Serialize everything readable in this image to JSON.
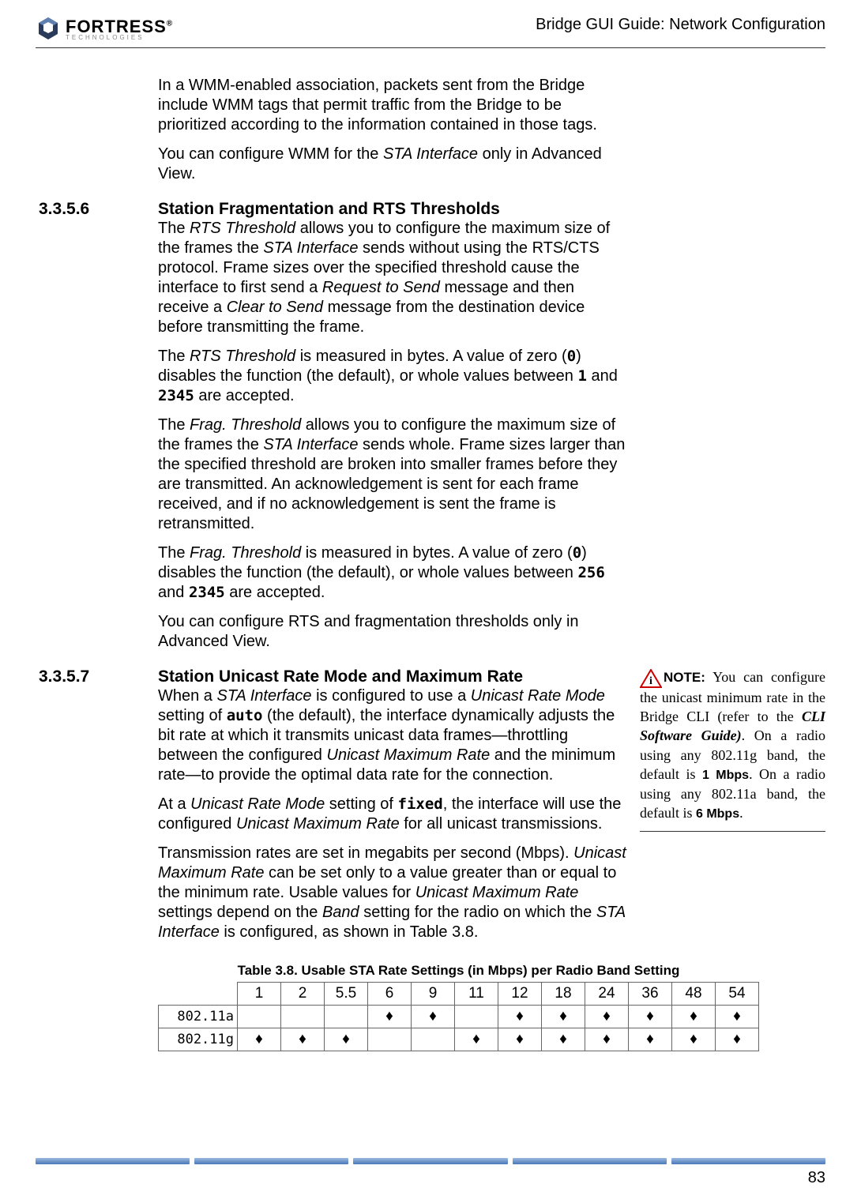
{
  "header": {
    "logo_name": "FORTRESS",
    "logo_sub": "TECHNOLOGIES",
    "title": "Bridge GUI Guide: Network Configuration"
  },
  "intro": {
    "p1_a": "In a WMM-enabled association, packets sent from the Bridge include WMM tags that permit traffic from the Bridge to be prioritized according to the information contained in those tags.",
    "p2_a": "You can configure WMM for the ",
    "p2_i": "STA Interface",
    "p2_b": " only in Advanced View."
  },
  "sec6": {
    "num": "3.3.5.6",
    "title": "Station Fragmentation and RTS Thresholds",
    "p1_a": "The ",
    "p1_i1": "RTS Threshold",
    "p1_b": " allows you to configure the maximum size of the frames the ",
    "p1_i2": "STA Interface",
    "p1_c": " sends without using the RTS/CTS protocol. Frame sizes over the specified threshold cause the interface to first send a ",
    "p1_i3": "Request to Send",
    "p1_d": " message and then receive a ",
    "p1_i4": "Clear to Send",
    "p1_e": " message from the destination device before transmitting the frame.",
    "p2_a": "The ",
    "p2_i": "RTS Threshold",
    "p2_b": " is measured in bytes. A value of zero (",
    "p2_m1": "0",
    "p2_c": ") disables the function (the default), or whole values between ",
    "p2_m2": "1",
    "p2_d": " and ",
    "p2_m3": "2345",
    "p2_e": " are accepted.",
    "p3_a": "The ",
    "p3_i1": "Frag. Threshold",
    "p3_b": " allows you to configure the maximum size of the frames the ",
    "p3_i2": "STA Interface",
    "p3_c": " sends whole. Frame sizes larger than the specified threshold are broken into smaller frames before they are transmitted. An acknowledgement is sent for each frame received, and if no acknowledgement is sent the frame is retransmitted.",
    "p4_a": "The ",
    "p4_i": "Frag. Threshold",
    "p4_b": " is measured in bytes. A value of zero (",
    "p4_m1": "0",
    "p4_c": ") disables the function (the default), or whole values between ",
    "p4_m2": "256",
    "p4_d": " and ",
    "p4_m3": "2345",
    "p4_e": " are accepted.",
    "p5": "You can configure RTS and fragmentation thresholds only in Advanced View."
  },
  "sec7": {
    "num": "3.3.5.7",
    "title": "Station Unicast Rate Mode and Maximum Rate",
    "p1_a": "When a ",
    "p1_i1": "STA Interface",
    "p1_b": " is configured to use a ",
    "p1_i2": "Unicast Rate Mode",
    "p1_c": " setting of ",
    "p1_m1": "auto",
    "p1_d": " (the default), the interface dynamically adjusts the bit rate at which it transmits unicast data frames—throttling between the configured ",
    "p1_i3": "Unicast Maximum Rate",
    "p1_e": " and the minimum rate—to provide the optimal data rate for the connection.",
    "p2_a": "At a ",
    "p2_i1": "Unicast Rate Mode",
    "p2_b": " setting of ",
    "p2_m1": "fixed",
    "p2_c": ", the interface will use the configured ",
    "p2_i2": "Unicast Maximum Rate",
    "p2_d": " for all unicast transmissions.",
    "p3_a": "Transmission rates are set in megabits per second (Mbps). ",
    "p3_i1": "Unicast Maximum Rate",
    "p3_b": " can be set only to a value greater than or equal to the minimum rate. Usable values for ",
    "p3_i2": "Unicast Maximum Rate",
    "p3_c": " settings depend on the ",
    "p3_i3": "Band",
    "p3_d": " setting for the radio on which the ",
    "p3_i4": "STA Interface",
    "p3_e": " is configured, as shown in Table 3.8."
  },
  "note": {
    "label": "NOTE:",
    "a": " You can configure the unicast minimum rate in the Bridge CLI (refer to the ",
    "bi1": "CLI Software Guide)",
    "b": ". On a radio using any 802.11g band, the default is ",
    "m1": "1 Mbps",
    "c": ". On a radio using any 802.11a band, the default is ",
    "m2": "6 Mbps",
    "d": "."
  },
  "table": {
    "caption": "Table 3.8. Usable STA Rate Settings (in Mbps) per Radio Band Setting",
    "cols": [
      "1",
      "2",
      "5.5",
      "6",
      "9",
      "11",
      "12",
      "18",
      "24",
      "36",
      "48",
      "54"
    ],
    "rows": [
      {
        "label": "802.11a",
        "marks": [
          "",
          "",
          "",
          "♦",
          "♦",
          "",
          "♦",
          "♦",
          "♦",
          "♦",
          "♦",
          "♦"
        ]
      },
      {
        "label": "802.11g",
        "marks": [
          "♦",
          "♦",
          "♦",
          "",
          "",
          "♦",
          "♦",
          "♦",
          "♦",
          "♦",
          "♦",
          "♦"
        ]
      }
    ]
  },
  "chart_data": {
    "type": "table",
    "title": "Table 3.8. Usable STA Rate Settings (in Mbps) per Radio Band Setting",
    "columns": [
      1,
      2,
      5.5,
      6,
      9,
      11,
      12,
      18,
      24,
      36,
      48,
      54
    ],
    "rows": {
      "802.11a": [
        false,
        false,
        false,
        true,
        true,
        false,
        true,
        true,
        true,
        true,
        true,
        true
      ],
      "802.11g": [
        true,
        true,
        true,
        false,
        false,
        true,
        true,
        true,
        true,
        true,
        true,
        true
      ]
    }
  },
  "page_number": "83"
}
